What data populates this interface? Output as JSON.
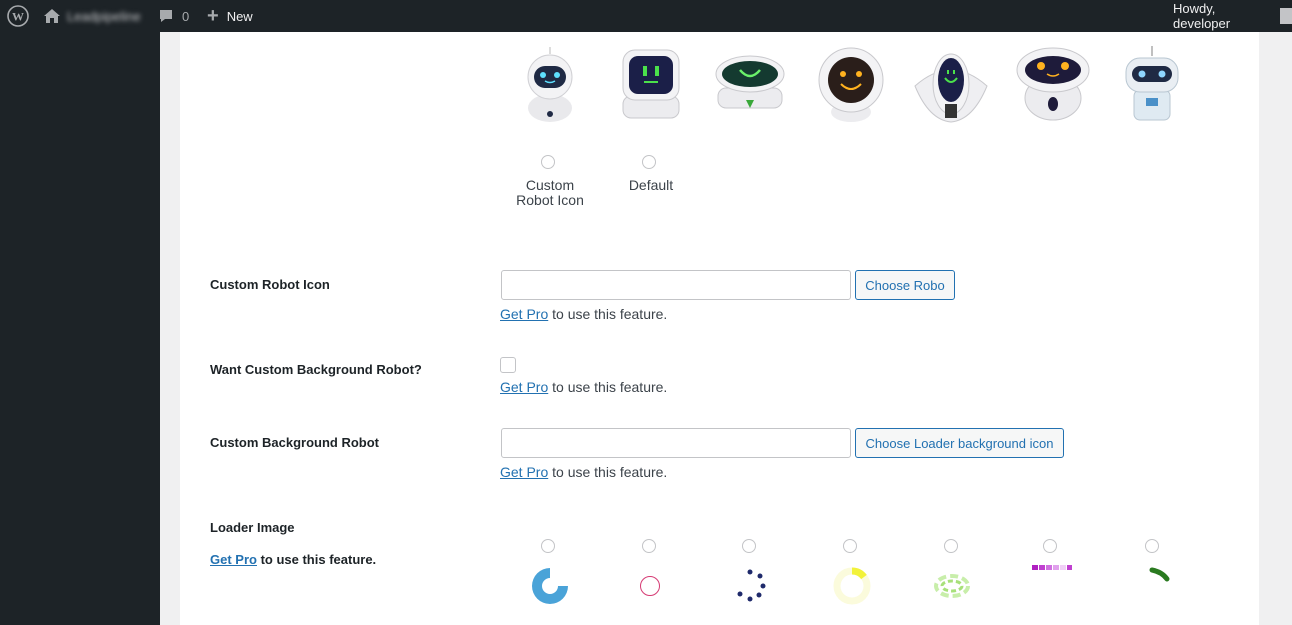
{
  "adminbar": {
    "site_name": "Leadpipeline",
    "comments_count": "0",
    "new_label": "New",
    "greeting": "Howdy, developer"
  },
  "robot_choice": {
    "options": [
      {
        "label": "Custom Robot Icon"
      },
      {
        "label": "Default"
      }
    ]
  },
  "custom_robot_icon": {
    "label": "Custom Robot Icon",
    "value": "",
    "button": "Choose Robo",
    "pro_link": "Get Pro",
    "pro_text": " to use this feature."
  },
  "custom_background_toggle": {
    "label": "Want Custom Background Robot?",
    "checked": false,
    "pro_link": "Get Pro",
    "pro_text": " to use this feature."
  },
  "custom_background_robot": {
    "label": "Custom Background Robot",
    "value": "",
    "button": "Choose Loader background icon",
    "pro_link": "Get Pro",
    "pro_text": " to use this feature."
  },
  "loader_image": {
    "label": "Loader Image",
    "pro_link": "Get Pro",
    "pro_text": " to use this feature."
  },
  "colors": {
    "admin_bar": "#1d2327",
    "link": "#2271b1",
    "accent_blue": "#4aa3d8",
    "loader_pink": "#d63b74",
    "loader_navy": "#1f2a6b",
    "loader_yellow": "#f2f23a",
    "loader_green": "#a8e07a",
    "loader_purple": "#b020c0",
    "loader_darkgreen": "#2a7a20"
  }
}
